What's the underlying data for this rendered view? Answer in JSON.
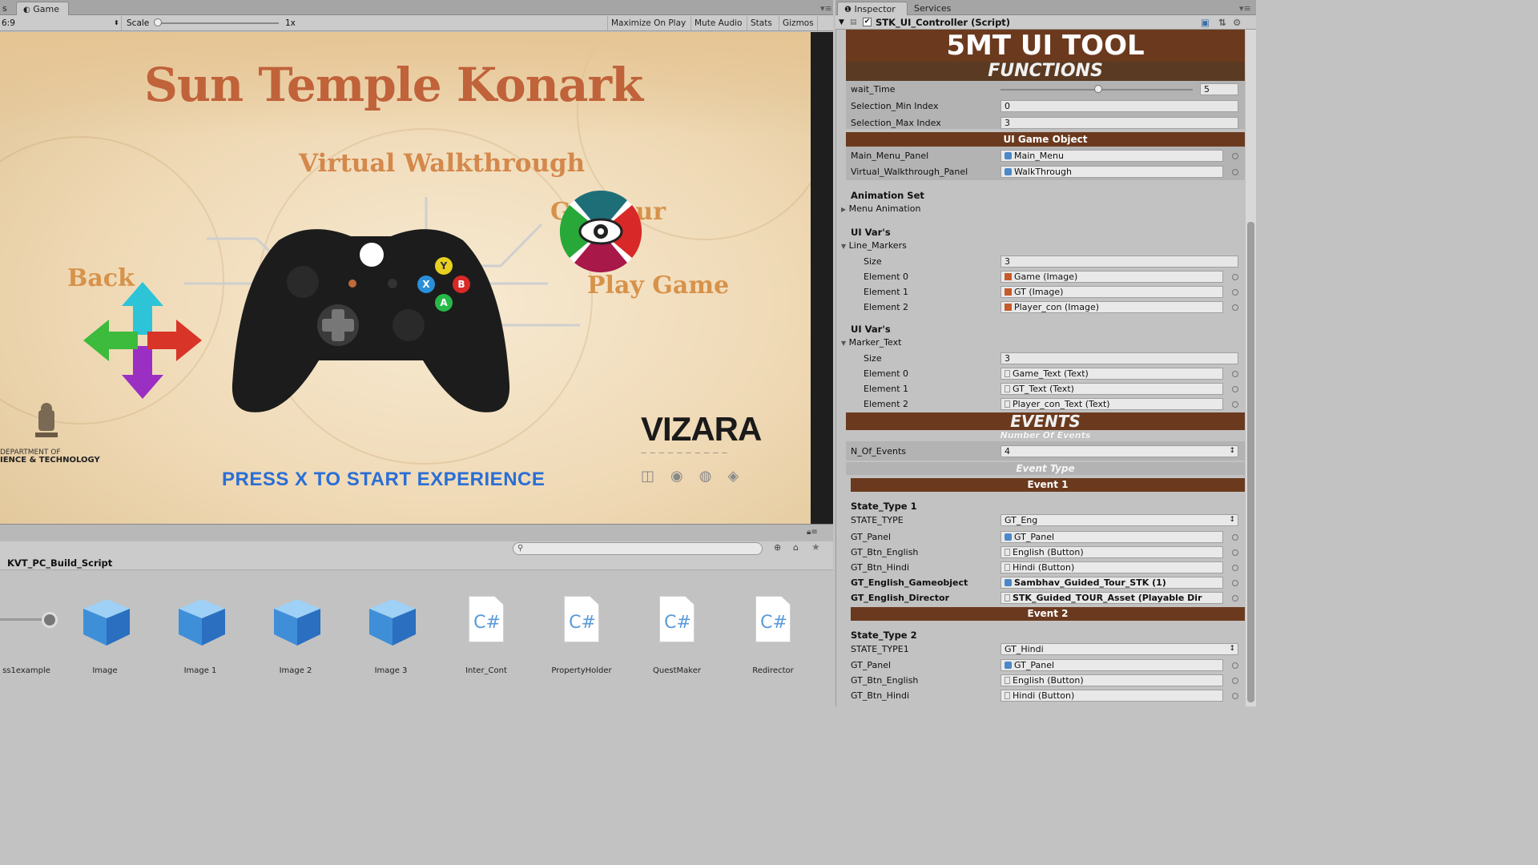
{
  "game_tab": {
    "left_stub": "s",
    "label": "Game",
    "icon": "game-icon"
  },
  "toolbar": {
    "aspect": "6:9",
    "scale_label": "Scale",
    "scale_value": "1x",
    "maximize_on_play": "Maximize On Play",
    "mute_audio": "Mute Audio",
    "stats": "Stats",
    "gizmos": "Gizmos"
  },
  "game": {
    "title": "Sun Temple Konark",
    "subtitle": "Virtual Walkthrough",
    "back_label": "Back",
    "guided_tour_label": "G    d Tour",
    "play_game_label": "Play Game",
    "press_label": "PRESS X TO START EXPERIENCE",
    "dept_line1": "DEPARTMENT OF",
    "dept_line2": "IENCE & TECHNOLOGY",
    "vizara_logo": "VIZARA",
    "buttons": {
      "y": "Y",
      "x": "X",
      "b": "B",
      "a": "A"
    }
  },
  "project": {
    "breadcrumb": "KVT_PC_Build_Script",
    "assets": [
      {
        "name": "ss1example",
        "kind": "slider"
      },
      {
        "name": "Image",
        "kind": "prefab"
      },
      {
        "name": "Image 1",
        "kind": "prefab"
      },
      {
        "name": "Image 2",
        "kind": "prefab"
      },
      {
        "name": "Image 3",
        "kind": "prefab"
      },
      {
        "name": "Inter_Cont",
        "kind": "script"
      },
      {
        "name": "PropertyHolder",
        "kind": "script"
      },
      {
        "name": "QuestMaker",
        "kind": "script"
      },
      {
        "name": "Redirector",
        "kind": "script"
      }
    ],
    "script_glyph": "C#"
  },
  "inspector": {
    "tab_label": "Inspector",
    "services_label": "Services",
    "component_title": "STK_UI_Controller (Script)",
    "banner": "5MT UI TOOL",
    "functions": "FUNCTIONS",
    "wait_time_label": "wait_Time",
    "wait_time_value": "5",
    "sel_min_label": "Selection_Min Index",
    "sel_min_value": "0",
    "sel_max_label": "Selection_Max Index",
    "sel_max_value": "3",
    "ui_game_object": "UI Game Object",
    "main_menu_panel_label": "Main_Menu_Panel",
    "main_menu_panel_value": "Main_Menu",
    "walkthrough_panel_label": "Virtual_Walkthrough_Panel",
    "walkthrough_panel_value": "WalkThrough",
    "animation_set": "Animation Set",
    "menu_animation": "Menu Animation",
    "ui_vars_1": "UI Var's",
    "line_markers": "Line_Markers",
    "size_label": "Size",
    "line_markers_size": "3",
    "line_markers_elements": [
      {
        "label": "Element 0",
        "value": "Game (Image)"
      },
      {
        "label": "Element 1",
        "value": "GT (Image)"
      },
      {
        "label": "Element 2",
        "value": "Player_con (Image)"
      }
    ],
    "ui_vars_2": "UI Var's",
    "marker_text": "Marker_Text",
    "marker_text_size": "3",
    "marker_text_elements": [
      {
        "label": "Element 0",
        "value": "Game_Text (Text)"
      },
      {
        "label": "Element 1",
        "value": "GT_Text (Text)"
      },
      {
        "label": "Element 2",
        "value": "Player_con_Text (Text)"
      }
    ],
    "events": "EVENTS",
    "number_of_events": "Number Of Events",
    "n_of_events_label": "N_Of_Events",
    "n_of_events_value": "4",
    "event_type": "Event Type",
    "event1": {
      "header": "Event 1",
      "state_type_title": "State_Type 1",
      "state_label": "STATE_TYPE",
      "state_value": "GT_Eng",
      "fields": [
        {
          "label": "GT_Panel",
          "value": "GT_Panel"
        },
        {
          "label": "GT_Btn_English",
          "value": "English (Button)"
        },
        {
          "label": "GT_Btn_Hindi",
          "value": "Hindi (Button)"
        },
        {
          "label": "GT_English_Gameobject",
          "value": "Sambhav_Guided_Tour_STK (1)"
        },
        {
          "label": "GT_English_Director",
          "value": "STK_Guided_TOUR_Asset (Playable Dir"
        }
      ]
    },
    "event2": {
      "header": "Event 2",
      "state_type_title": "State_Type 2",
      "state_label": "STATE_TYPE1",
      "state_value": "GT_Hindi",
      "fields": [
        {
          "label": "GT_Panel",
          "value": "GT_Panel"
        },
        {
          "label": "GT_Btn_English",
          "value": "English (Button)"
        },
        {
          "label": "GT_Btn_Hindi",
          "value": "Hindi (Button)"
        }
      ]
    }
  }
}
